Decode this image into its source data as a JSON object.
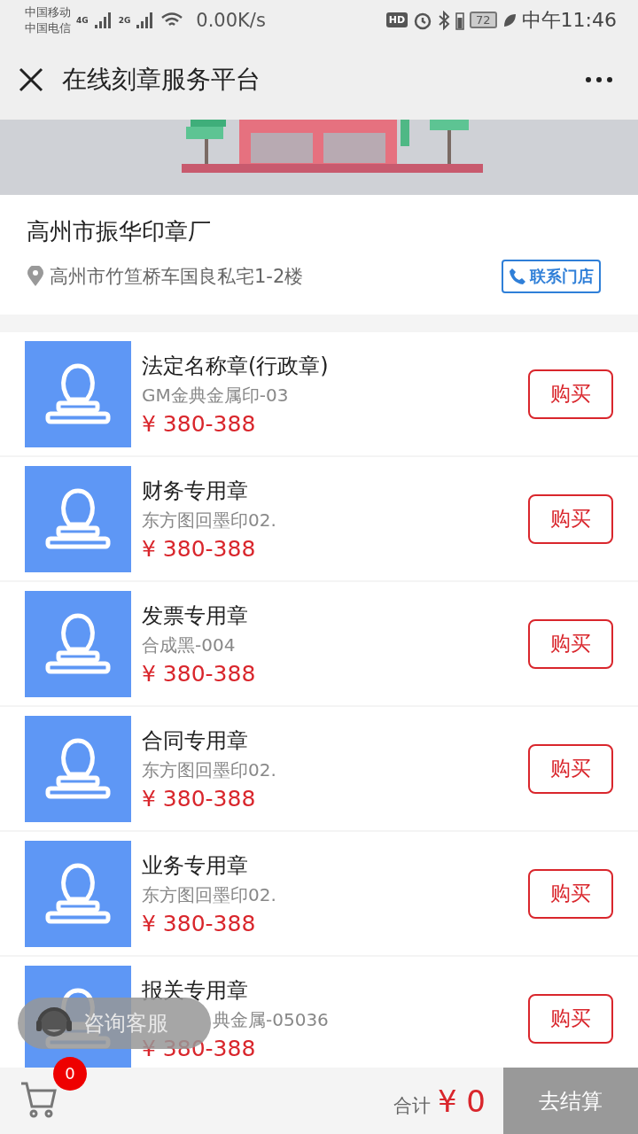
{
  "status_bar": {
    "carriers": [
      "中国移动",
      "中国电信"
    ],
    "networks": [
      "4G",
      "2G"
    ],
    "speed": "0.00K/s",
    "hd": "HD",
    "battery": "72",
    "time": "中午11:46"
  },
  "title_bar": {
    "title": "在线刻章服务平台"
  },
  "shop": {
    "name": "高州市振华印章厂",
    "address": "高州市竹笪桥车国良私宅1-2楼",
    "contact_button": "联系门店"
  },
  "products": [
    {
      "name": "法定名称章(行政章)",
      "material": "GM金典金属印-03",
      "price": "¥ 380-388",
      "buy": "购买",
      "partly_hidden": false
    },
    {
      "name": "财务专用章",
      "material": "东方图回墨印02.",
      "price": "¥ 380-388",
      "buy": "购买",
      "partly_hidden": false
    },
    {
      "name": "发票专用章",
      "material": "合成黑-004",
      "price": "¥ 380-388",
      "buy": "购买",
      "partly_hidden": false
    },
    {
      "name": "合同专用章",
      "material": "东方图回墨印02.",
      "price": "¥ 380-388",
      "buy": "购买",
      "partly_hidden": false
    },
    {
      "name": "业务专用章",
      "material": "东方图回墨印02.",
      "price": "¥ 380-388",
      "buy": "购买",
      "partly_hidden": false
    },
    {
      "name": "报关专用章",
      "material": "典金属-05036",
      "price": "¥ 380-388",
      "buy": "购买",
      "partly_hidden": true
    }
  ],
  "consult_button": "咨询客服",
  "cart": {
    "count": "0",
    "total_label": "合计",
    "total": "¥ 0",
    "checkout": "去结算"
  }
}
